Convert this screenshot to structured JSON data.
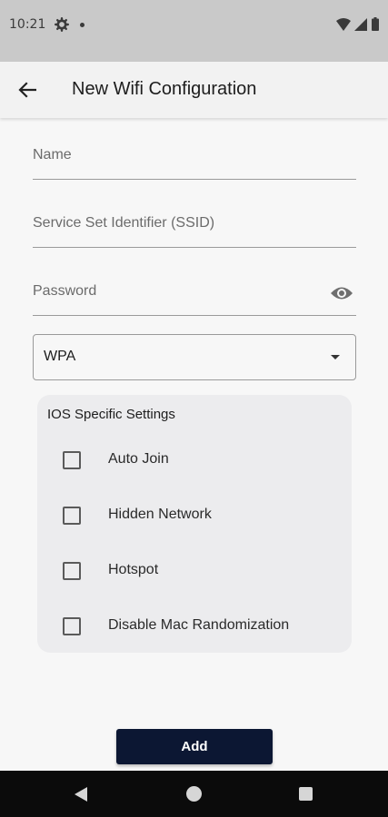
{
  "status_bar": {
    "time": "10:21",
    "icons": [
      "gear-icon",
      "notification-dot-icon",
      "wifi-icon",
      "signal-icon",
      "battery-icon"
    ]
  },
  "app_bar": {
    "title": "New Wifi Configuration",
    "back_icon": "arrow-left-icon"
  },
  "form": {
    "name_placeholder": "Name",
    "ssid_placeholder": "Service Set Identifier (SSID)",
    "password_placeholder": "Password",
    "password_toggle_icon": "eye-icon",
    "security_type": {
      "selected": "WPA"
    }
  },
  "ios_settings": {
    "title": "IOS Specific Settings",
    "options": [
      {
        "label": "Auto Join",
        "checked": false
      },
      {
        "label": "Hidden Network",
        "checked": false
      },
      {
        "label": "Hotspot",
        "checked": false
      },
      {
        "label": "Disable Mac Randomization",
        "checked": false
      }
    ]
  },
  "actions": {
    "add_label": "Add"
  },
  "colors": {
    "status_bar_bg": "#c9c9c9",
    "app_bar_bg": "#f2f2f2",
    "card_bg": "#ececee",
    "primary_button_bg": "#0c1733",
    "nav_bar_bg": "#0b0b0b"
  },
  "nav_bar": {
    "icons": [
      "back-triangle-icon",
      "home-circle-icon",
      "recents-square-icon"
    ]
  }
}
